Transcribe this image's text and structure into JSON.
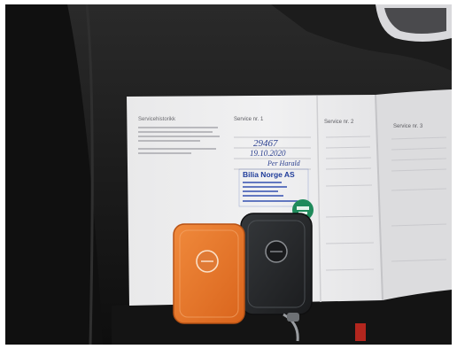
{
  "photo": {
    "stamp": {
      "title": "Bilia Norge AS"
    },
    "handwriting": {
      "line1": "29467",
      "line2": "19.10.2020",
      "line3": "Per Harald"
    },
    "booklet": {
      "left_page_heading": "Servicehistorikk",
      "section_heading_1": "Service nr. 1",
      "section_heading_2": "Service nr. 2",
      "section_heading_3": "Service nr. 3"
    },
    "colors": {
      "orange_key": "#e8742a",
      "black_key": "#222426",
      "stamp_blue": "#1f3c9a",
      "sticker_green": "#1f8a5b"
    }
  }
}
